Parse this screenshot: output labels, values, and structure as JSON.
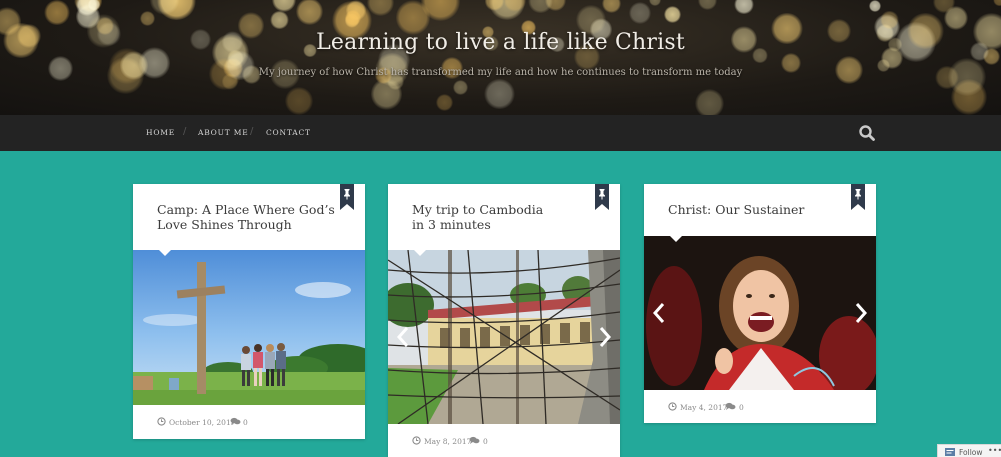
{
  "site": {
    "title": "Learning to live a life like Christ",
    "tagline": "My journey of how Christ has transformed my life and how he continues to transform me today"
  },
  "nav": {
    "items": [
      {
        "label": "HOME"
      },
      {
        "label": "ABOUT ME"
      },
      {
        "label": "CONTACT"
      }
    ],
    "separator": "/",
    "search_icon": "search-icon"
  },
  "posts": [
    {
      "title": "Camp: A Place Where God’s Love Shines Through",
      "date": "October 10, 2017",
      "comments": "0",
      "image": "cross-on-hill-photo"
    },
    {
      "title": "My trip to Cambodia in 3 minutes",
      "date": "May 8, 2017",
      "comments": "0",
      "image": "barbed-wire-school-photo"
    },
    {
      "title": "Christ: Our Sustainer",
      "date": "May 4, 2017",
      "comments": "0",
      "image": "graduation-smile-photo"
    }
  ],
  "follow": {
    "label": "Follow",
    "more": "•••"
  },
  "colors": {
    "background": "#23a99a",
    "nav_bg": "#232323",
    "bookmark": "#2f3a4b"
  }
}
